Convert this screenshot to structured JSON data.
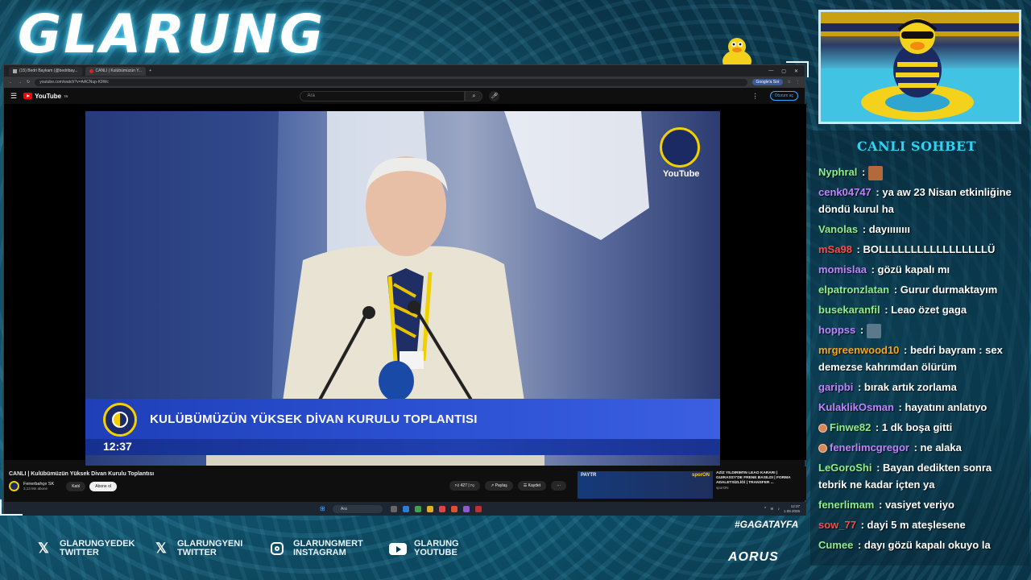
{
  "overlay": {
    "brand_title": "GLARUNG",
    "hashtag": "#GAGATAYFA",
    "sponsor": "AORUS",
    "socials": [
      {
        "icon": "x-icon",
        "line1": "GLARUNGYEDEK",
        "line2": "TWITTER"
      },
      {
        "icon": "x-icon",
        "line1": "GLARUNGYENI",
        "line2": "TWITTER"
      },
      {
        "icon": "instagram-icon",
        "line1": "GLARUNGMERT",
        "line2": "INSTAGRAM"
      },
      {
        "icon": "youtube-icon",
        "line1": "GLARUNG",
        "line2": "YOUTUBE"
      }
    ]
  },
  "browser": {
    "tabs": [
      {
        "label": "(15) Bedri Baykam (@bedribay...",
        "icon": "x-icon"
      },
      {
        "label": "CANLI | Kulübümüzün Y...",
        "icon": "youtube-icon"
      }
    ],
    "url": "youtube.com/watch?v=AACNup-K9Wc",
    "google_btn": "Google'a Sor"
  },
  "youtube": {
    "logo_text": "YouTube",
    "logo_sup": "TR",
    "search_placeholder": "Ara",
    "signin": "Oturum aç",
    "video_title": "CANLI | Kulübümüzün Yüksek Divan Kurulu Toplantısı",
    "channel_name": "Fenerbahçe SK",
    "channel_subs": "3,13 Mn abone",
    "join_btn": "Katıl",
    "subscribe_btn": "Abone ol",
    "likes": "427",
    "share": "Paylaş",
    "save": "Kaydet",
    "rec_thumb_text": "PAYTR",
    "rec_thumb_brand": "sporON",
    "rec_title": "AZİZ YILDIRIM'IN LEAO KARARI | GUIRASSY'DE FRENE BASILDI | FORMA ADALETSİZLİĞİ | TRANSFER ...",
    "rec_source": "sporON",
    "overlay_banner": "KULÜBÜMÜZÜN YÜKSEK DİVAN KURULU TOPLANTISI",
    "overlay_clock": "12:37",
    "watermark": "YouTube"
  },
  "taskbar": {
    "search": "Ara",
    "time": "12:37",
    "date": "1.08.2026"
  },
  "chat": {
    "title": "CANLI SOHBET",
    "messages": [
      {
        "user": "Nyphral",
        "color": "#8cf08c",
        "text": "",
        "emote": "#b26a3c"
      },
      {
        "user": "cenk04747",
        "color": "#c084fc",
        "text": "ya aw 23 Nisan etkinliğine döndü kurul ha"
      },
      {
        "user": "Vanolas",
        "color": "#8cf08c",
        "text": "dayıııııııı"
      },
      {
        "user": "mSa98",
        "color": "#ff4a4a",
        "text": "BOLLLLLLLLLLLLLLLLLÜ"
      },
      {
        "user": "momislaa",
        "color": "#c084fc",
        "text": "gözü kapalı mı"
      },
      {
        "user": "elpatronzlatan",
        "color": "#8cf08c",
        "text": "Gurur durmaktayım"
      },
      {
        "user": "busekaranfil",
        "color": "#8cf08c",
        "text": "Leao özet gaga"
      },
      {
        "user": "hoppss",
        "color": "#c084fc",
        "text": "",
        "emote": "#5a7a8c"
      },
      {
        "user": "mrgreenwood10",
        "color": "#f5a623",
        "text": "bedri bayram : sex demezse kahrımdan ölürüm"
      },
      {
        "user": "garipbi",
        "color": "#c084fc",
        "text": "bırak artık zorlama"
      },
      {
        "user": "KulaklikOsman",
        "color": "#c084fc",
        "text": "hayatını anlatıyo"
      },
      {
        "user": "Finwe82",
        "color": "#8cf08c",
        "text": "1 dk boşa gitti",
        "badge": true
      },
      {
        "user": "fenerlimcgregor",
        "color": "#c084fc",
        "text": "ne alaka",
        "badge": true
      },
      {
        "user": "LeGoroShi",
        "color": "#8cf08c",
        "text": "Bayan dedikten sonra tebrik ne kadar içten ya"
      },
      {
        "user": "fenerlimam",
        "color": "#8cf08c",
        "text": "vasiyet veriyo"
      },
      {
        "user": "sow_77",
        "color": "#ff4a4a",
        "text": "dayi 5 m ateşlesene"
      },
      {
        "user": "Cumee",
        "color": "#8cf08c",
        "text": "dayı gözü kapalı okuyo la"
      }
    ]
  }
}
